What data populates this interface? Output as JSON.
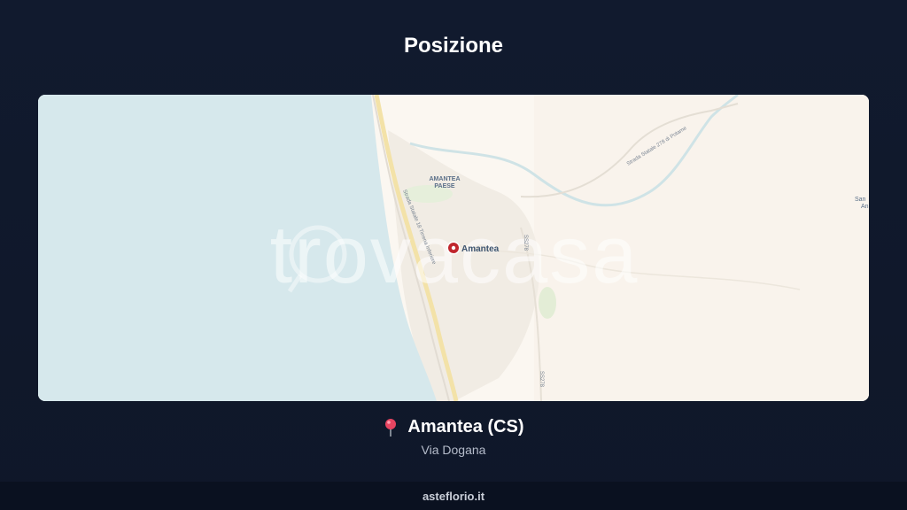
{
  "header": {
    "title": "Posizione"
  },
  "map": {
    "watermark": "trovacasa",
    "labels": {
      "town_main": "Amantea",
      "town_paese_1": "AMANTEA",
      "town_paese_2": "PAESE",
      "road_coastal": "Strada Statale 18 Tirrena Inferiore",
      "road_278": "Strada Statale 278 di Potame",
      "road_sp_1": "SS278",
      "road_sp_2": "SS278",
      "edge_1": "San",
      "edge_2": "An"
    },
    "colors": {
      "sea": "#d6e8ec",
      "land": "#fbf7f1",
      "marker": "#c0262d"
    }
  },
  "location": {
    "pin_icon": "round-pushpin-icon",
    "name": "Amantea (CS)",
    "address": "Via Dogana"
  },
  "footer": {
    "site": "asteflorio.it"
  }
}
